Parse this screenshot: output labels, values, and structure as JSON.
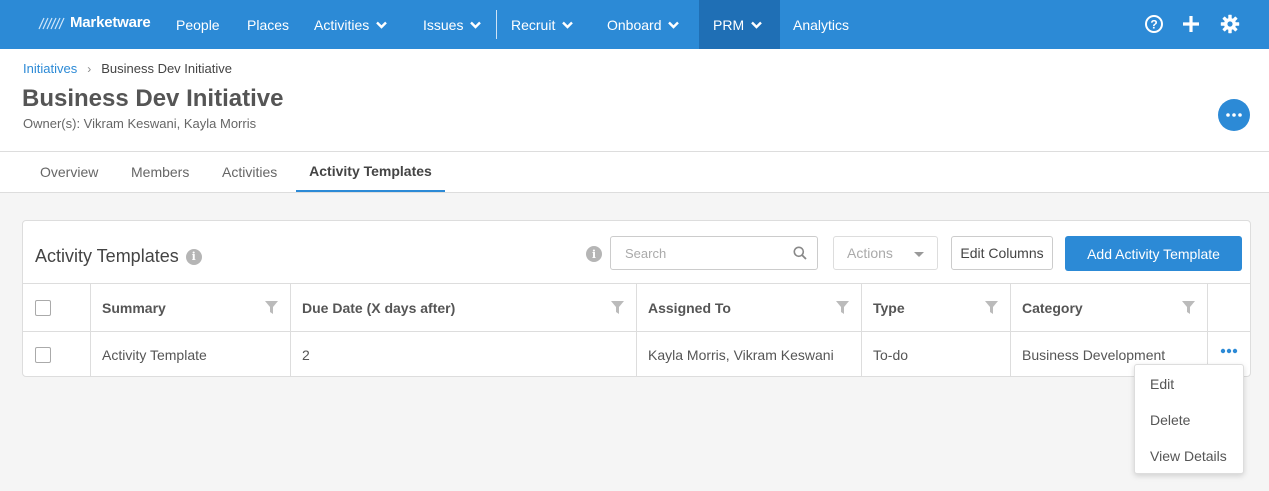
{
  "nav": {
    "brand": "Marketware",
    "items": [
      {
        "label": "People"
      },
      {
        "label": "Places"
      },
      {
        "label": "Activities"
      },
      {
        "label": "Issues"
      },
      {
        "label": "Recruit"
      },
      {
        "label": "Onboard"
      },
      {
        "label": "PRM"
      },
      {
        "label": "Analytics"
      }
    ],
    "active": "PRM",
    "right_icons": [
      "help-icon",
      "plus-icon",
      "gear-icon"
    ]
  },
  "breadcrumb": {
    "parent": "Initiatives",
    "current": "Business Dev Initiative"
  },
  "page": {
    "title": "Business Dev Initiative",
    "owners": "Owner(s): Vikram Keswani, Kayla Morris"
  },
  "tabs": [
    {
      "label": "Overview"
    },
    {
      "label": "Members"
    },
    {
      "label": "Activities"
    },
    {
      "label": "Activity Templates"
    }
  ],
  "active_tab": "Activity Templates",
  "card": {
    "title": "Activity Templates",
    "search_placeholder": "Search",
    "actions_label": "Actions",
    "edit_columns_label": "Edit Columns",
    "add_label": "Add Activity Template"
  },
  "table": {
    "columns": [
      "Summary",
      "Due Date (X days after)",
      "Assigned To",
      "Type",
      "Category"
    ],
    "rows": [
      {
        "summary": "Activity Template",
        "due": "2",
        "assigned": "Kayla Morris, Vikram Keswani",
        "type": "To-do",
        "category": "Business Development"
      }
    ]
  },
  "row_menu": {
    "items": [
      "Edit",
      "Delete",
      "View Details"
    ]
  },
  "colors": {
    "primary": "#2c8ad6",
    "nav_active": "#1f6fb5"
  }
}
